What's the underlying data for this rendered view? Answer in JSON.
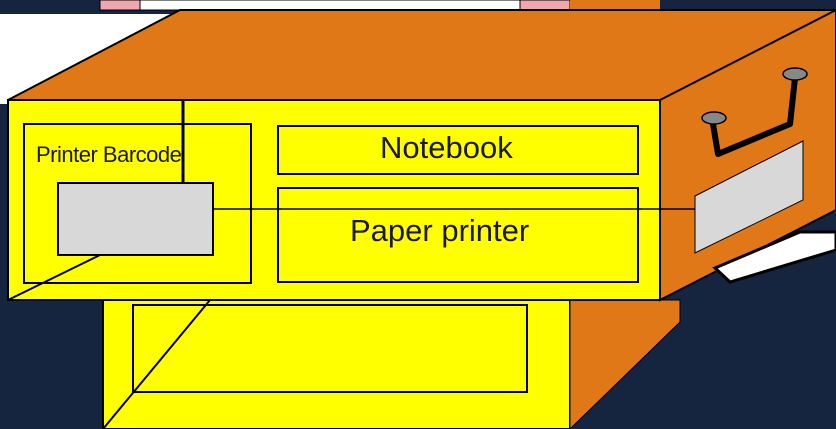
{
  "labels": {
    "printer_barcode": "Printer Barcode",
    "notebook": "Notebook",
    "paper_printer": "Paper printer"
  },
  "colors": {
    "background": "#15243f",
    "yellow": "#ffff00",
    "orange": "#e07818",
    "gray": "#d8d8d8",
    "pink": "#f2a7b0",
    "white": "#ffffff",
    "outline": "#000000"
  }
}
